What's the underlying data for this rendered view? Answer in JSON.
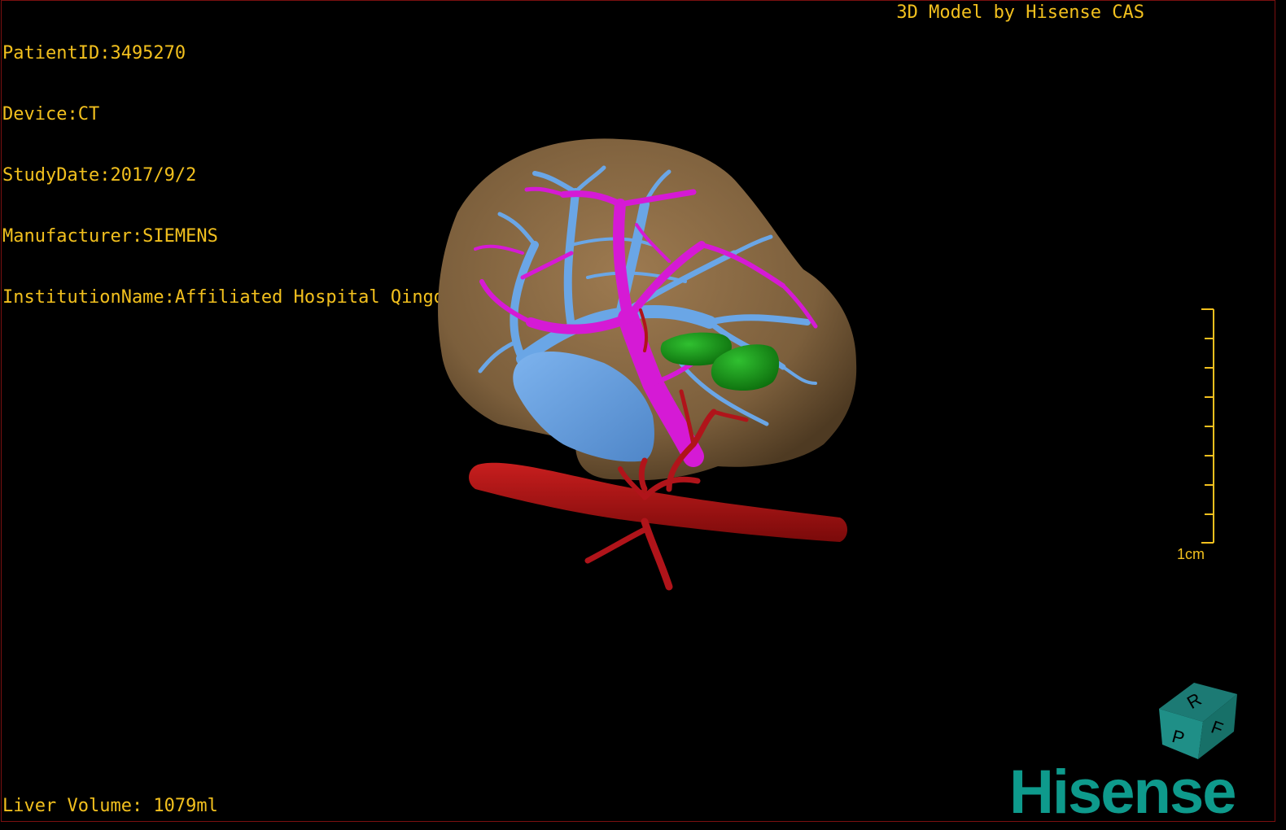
{
  "header": {
    "patient_id": "PatientID:3495270",
    "device": "Device:CT",
    "study_date": "StudyDate:2017/9/2",
    "manufacturer": "Manufacturer:SIEMENS",
    "institution": "InstitutionName:Affiliated Hospital Qingdao University-C"
  },
  "credit": "3D Model by Hisense CAS",
  "scale": {
    "label": "1cm"
  },
  "footer": {
    "volume": "Liver Volume: 1079ml"
  },
  "orientation_cube": {
    "faces": [
      "R",
      "F",
      "P"
    ]
  },
  "logo": {
    "text": "Hisense"
  },
  "colors": {
    "overlay_text": "#f2c01e",
    "liver": "#8a6a44",
    "portal_vein": "#d51ad5",
    "hepatic_vein": "#6aa6e6",
    "artery": "#b0141a",
    "tumor": "#1a9a1a",
    "brand": "#0e9a8c"
  }
}
